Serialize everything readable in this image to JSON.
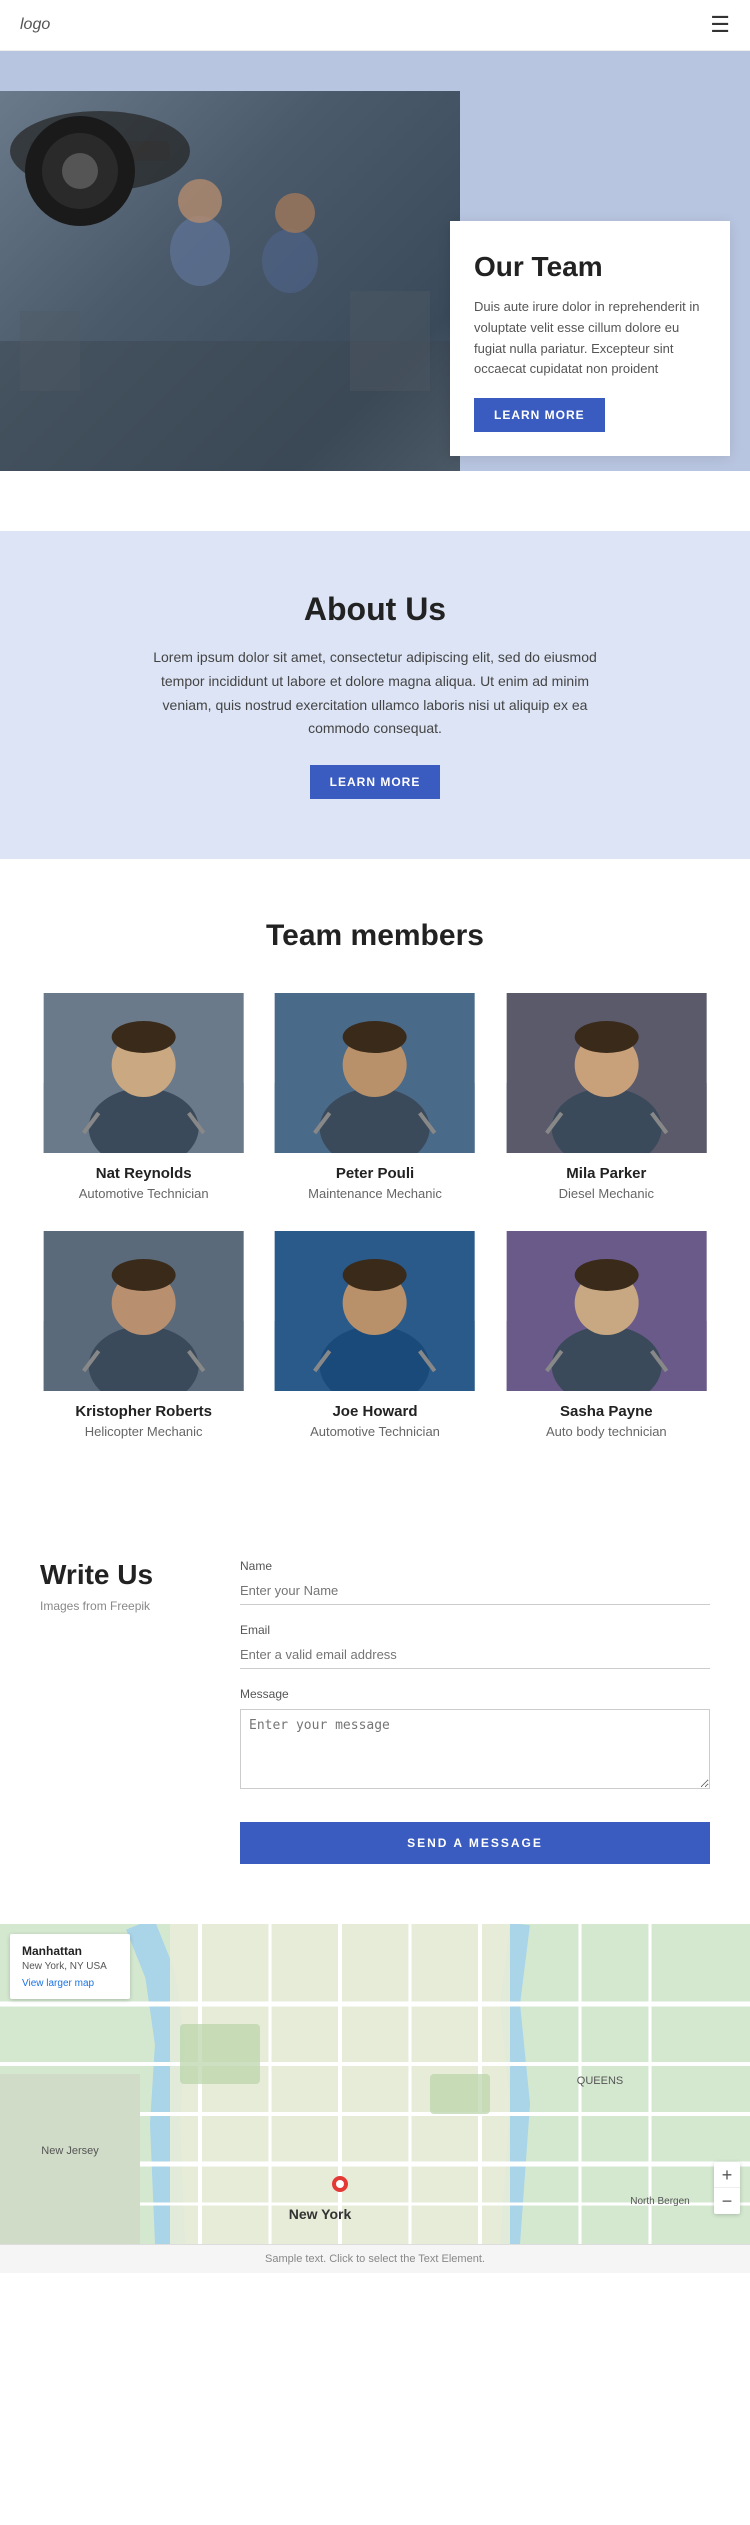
{
  "header": {
    "logo": "logo",
    "menu_icon": "☰"
  },
  "hero": {
    "title": "Our Team",
    "description": "Duis aute irure dolor in reprehenderit in voluptate velit esse cillum dolore eu fugiat nulla pariatur. Excepteur sint occaecat cupidatat non proident",
    "button": "LEARN MORE"
  },
  "about": {
    "title": "About Us",
    "description": "Lorem ipsum dolor sit amet, consectetur adipiscing elit, sed do eiusmod tempor incididunt ut labore et dolore magna aliqua. Ut enim ad minim veniam, quis nostrud exercitation ullamco laboris nisi ut aliquip ex ea commodo consequat.",
    "button": "LEARN MORE"
  },
  "team": {
    "title": "Team members",
    "members": [
      {
        "name": "Nat Reynolds",
        "role": "Automotive Technician",
        "photo_class": "photo-mechanic-1"
      },
      {
        "name": "Peter Pouli",
        "role": "Maintenance Mechanic",
        "photo_class": "photo-mechanic-2"
      },
      {
        "name": "Mila Parker",
        "role": "Diesel Mechanic",
        "photo_class": "photo-mechanic-3"
      },
      {
        "name": "Kristopher Roberts",
        "role": "Helicopter Mechanic",
        "photo_class": "photo-mechanic-4"
      },
      {
        "name": "Joe Howard",
        "role": "Automotive Technician",
        "photo_class": "photo-mechanic-5"
      },
      {
        "name": "Sasha Payne",
        "role": "Auto body technician",
        "photo_class": "photo-mechanic-6"
      }
    ]
  },
  "contact": {
    "title": "Write Us",
    "subtitle": "Images from Freepik",
    "form": {
      "name_label": "Name",
      "name_placeholder": "Enter your Name",
      "email_label": "Email",
      "email_placeholder": "Enter a valid email address",
      "message_label": "Message",
      "message_placeholder": "Enter your message",
      "send_button": "SEND A MESSAGE"
    }
  },
  "map": {
    "title": "Manhattan",
    "address": "New York, NY USA",
    "link": "View larger map",
    "zoom_in": "+",
    "zoom_out": "−"
  },
  "footer": {
    "text": "Sample text. Click to select the Text Element."
  }
}
